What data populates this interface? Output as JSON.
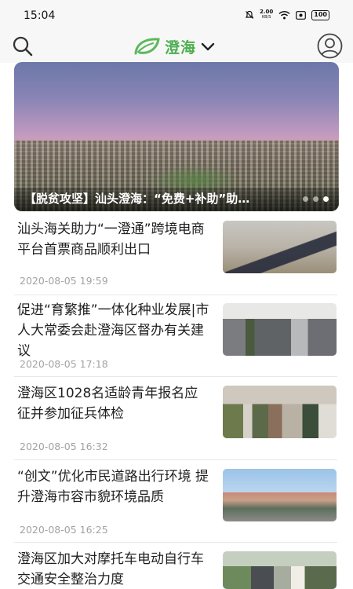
{
  "status_bar": {
    "time": "15:04",
    "net_speed": "2.00",
    "net_unit": "KB/S",
    "battery": "100"
  },
  "header": {
    "city": "澄海",
    "search_icon": "search-icon",
    "logo_icon": "leaf-logo-icon",
    "dropdown_icon": "chevron-down-icon",
    "user_icon": "user-avatar-icon",
    "accent_color": "#4caf50"
  },
  "banner": {
    "title": "【脱贫攻坚】汕头澄海：“免费+补助”助…",
    "dot_count": 3,
    "active_dot": 3
  },
  "news": [
    {
      "title": "汕头海关助力“一澄通”跨境电商平台首票商品顺利出口",
      "date": "2020-08-05 19:59"
    },
    {
      "title": "促进“育繁推”一体化种业发展|市人大常委会赴澄海区督办有关建议",
      "date": "2020-08-05 17:18"
    },
    {
      "title": "澄海区1028名适龄青年报名应征并参加征兵体检",
      "date": "2020-08-05 16:32"
    },
    {
      "title": "“创文”优化市民道路出行环境 提升澄海市容市貌环境品质",
      "date": "2020-08-05 16:25"
    },
    {
      "title": "澄海区加大对摩托车电动自行车交通安全整治力度",
      "date": ""
    }
  ]
}
